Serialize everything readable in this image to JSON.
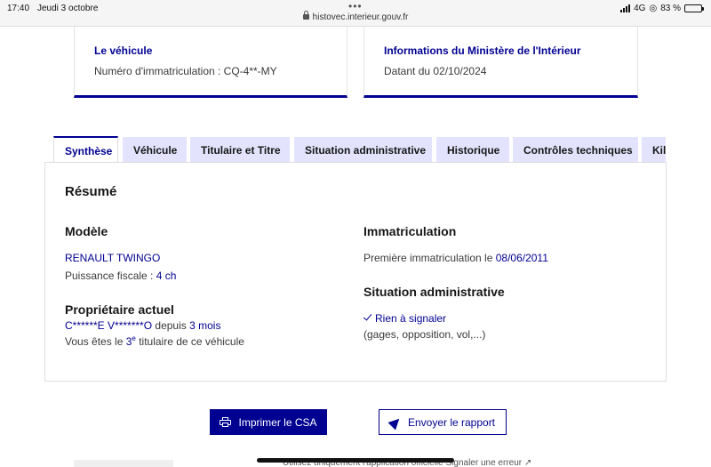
{
  "statusbar": {
    "time": "17:40",
    "date": "Jeudi 3 octobre",
    "url": "histovec.interieur.gouv.fr",
    "network": "4G",
    "battery": "83 %",
    "battery_level": 0.83
  },
  "cards": {
    "vehicle": {
      "title": "Le véhicule",
      "text": "Numéro d'immatriculation : CQ-4**-MY"
    },
    "ministry": {
      "title": "Informations du Ministère de l'Intérieur",
      "text": "Datant du 02/10/2024"
    }
  },
  "tabs": [
    {
      "label": "Synthèse",
      "active": true
    },
    {
      "label": "Véhicule",
      "active": false
    },
    {
      "label": "Titulaire et Titre",
      "active": false
    },
    {
      "label": "Situation administrative",
      "active": false
    },
    {
      "label": "Historique",
      "active": false
    },
    {
      "label": "Contrôles techniques",
      "active": false
    },
    {
      "label": "Kil",
      "active": false
    }
  ],
  "summary": {
    "title": "Résumé",
    "model": {
      "heading": "Modèle",
      "name": "RENAULT TWINGO",
      "power_label": "Puissance fiscale : ",
      "power_value": "4 ch"
    },
    "owner": {
      "heading": "Propriétaire actuel",
      "name": "C******E V*******O",
      "since_label": " depuis ",
      "since_value": "3 mois",
      "rank_prefix": "Vous êtes le ",
      "rank_num": "3",
      "rank_sup": "e",
      "rank_suffix": " titulaire de ce véhicule"
    },
    "registration": {
      "heading": "Immatriculation",
      "label": "Première immatriculation le ",
      "date": "08/06/2011"
    },
    "admin": {
      "heading": "Situation administrative",
      "status": "Rien à signaler",
      "detail": "(gages, opposition, vol,...)"
    }
  },
  "actions": {
    "print_label": "Imprimer le CSA",
    "send_label": "Envoyer le rapport"
  },
  "footer": {
    "text": "Utilisez uniquement l'application officielle Signaler une erreur ↗"
  }
}
